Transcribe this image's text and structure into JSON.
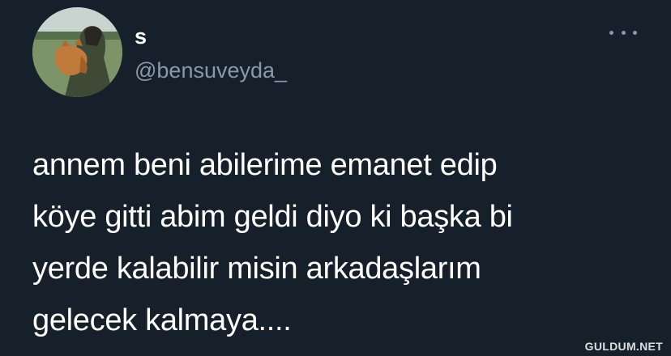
{
  "tweet": {
    "display_name": "s",
    "handle": "@bensuveyda_",
    "more_icon": "more-horizontal-icon",
    "avatar_icon": "profile-photo",
    "text_lines": [
      "annem beni abilerime emanet edip",
      "köye gitti abim geldi diyo ki başka bi",
      "yerde kalabilir misin arkadaşlarım",
      "gelecek kalmaya...."
    ]
  },
  "watermark": "GULDUM.NET",
  "colors": {
    "background": "#15202b",
    "text": "#ffffff",
    "secondary": "#8b98a5"
  }
}
